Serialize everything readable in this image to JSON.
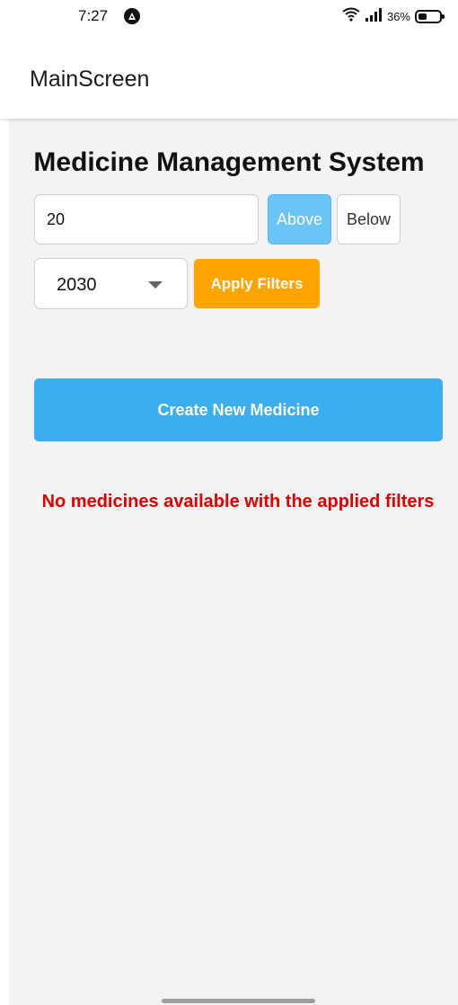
{
  "status_bar": {
    "time": "7:27",
    "battery_percent": "36%",
    "icons": [
      "app-notification-icon",
      "wifi-icon",
      "signal-icon",
      "battery-icon"
    ]
  },
  "header": {
    "title": "MainScreen"
  },
  "main": {
    "title": "Medicine Management System",
    "price_filter": {
      "value": "20"
    },
    "above_label": "Above",
    "below_label": "Below",
    "year_select": {
      "selected": "2030"
    },
    "apply_label": "Apply Filters",
    "create_label": "Create New Medicine",
    "empty_message": "No medicines available with the applied filters"
  },
  "colors": {
    "above_active": "#6ac4f6",
    "apply": "#ffa400",
    "create": "#3aaeee",
    "error_text": "#e20000",
    "background": "#f3f3f3"
  }
}
